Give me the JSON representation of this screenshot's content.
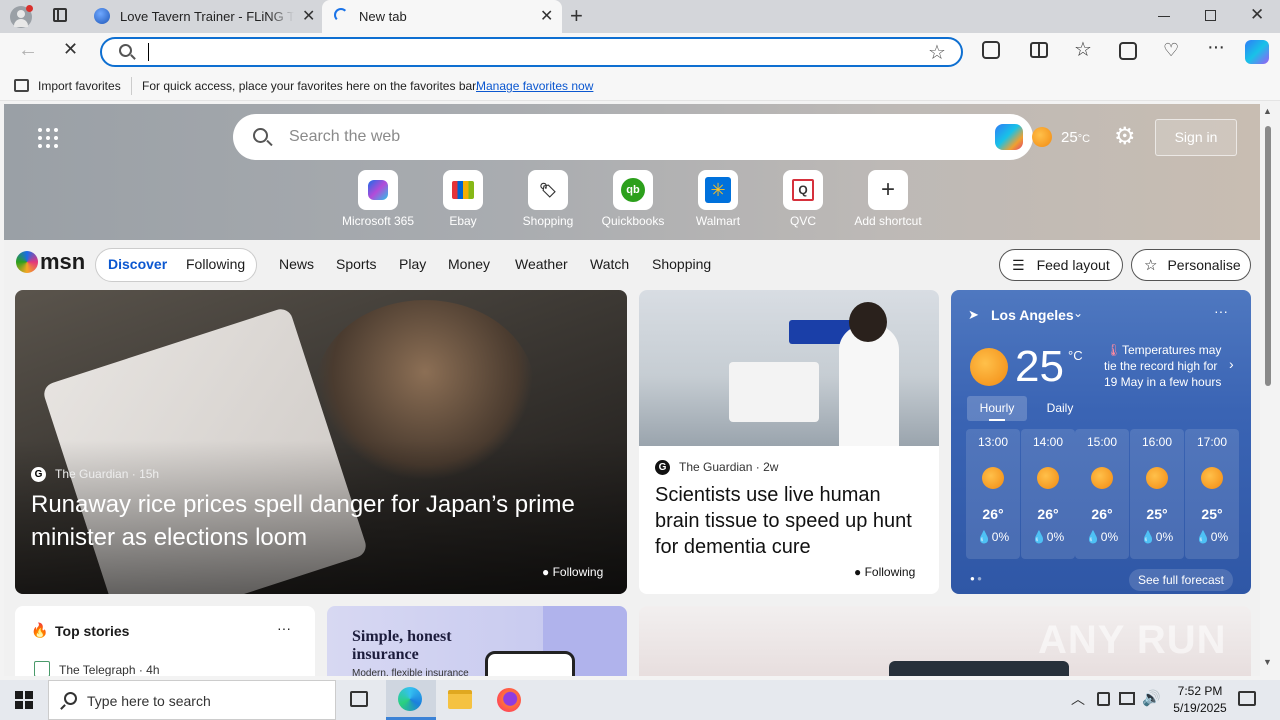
{
  "browser": {
    "tabs": [
      {
        "title": "Love Tavern Trainer - FLiNG Trainer"
      },
      {
        "title": "New tab"
      }
    ],
    "address_value": "",
    "favorites_bar": {
      "import_label": "Import favorites",
      "hint": "For quick access, place your favorites here on the favorites bar.",
      "manage_link": "Manage favorites now"
    }
  },
  "newtab": {
    "search_placeholder": "Search the web",
    "temperature": "25",
    "temp_unit": "°C",
    "sign_in": "Sign in",
    "shortcuts": [
      {
        "label": "Microsoft 365",
        "icon": "microsoft365-icon"
      },
      {
        "label": "Ebay",
        "icon": "ebay-icon"
      },
      {
        "label": "Shopping",
        "icon": "shopping-tag-icon"
      },
      {
        "label": "Quickbooks",
        "icon": "quickbooks-icon"
      },
      {
        "label": "Walmart",
        "icon": "walmart-icon"
      },
      {
        "label": "QVC",
        "icon": "qvc-icon"
      },
      {
        "label": "Add shortcut",
        "icon": "plus-icon"
      }
    ]
  },
  "msn": {
    "logo": "msn",
    "tabs": [
      "Discover",
      "Following"
    ],
    "nav": [
      "News",
      "Sports",
      "Play",
      "Money",
      "Weather",
      "Watch",
      "Shopping"
    ],
    "feed_layout": "Feed layout",
    "personalise": "Personalise",
    "hero_story": {
      "source": "The Guardian",
      "age": "15h",
      "title": "Runaway rice prices spell danger for Japan’s prime minister as elections loom",
      "following": "Following"
    },
    "second_story": {
      "source": "The Guardian",
      "age": "2w",
      "title": "Scientists use live human brain tissue to speed up hunt for dementia cure",
      "following": "Following"
    },
    "weather": {
      "location": "Los Angeles",
      "temp": "25",
      "unit": "°C",
      "alert": "Temperatures may tie the record high for 19 May in a few hours",
      "tabs": [
        "Hourly",
        "Daily"
      ],
      "hours": [
        {
          "time": "13:00",
          "temp": "26°",
          "precip": "0%"
        },
        {
          "time": "14:00",
          "temp": "26°",
          "precip": "0%"
        },
        {
          "time": "15:00",
          "temp": "26°",
          "precip": "0%"
        },
        {
          "time": "16:00",
          "temp": "25°",
          "precip": "0%"
        },
        {
          "time": "17:00",
          "temp": "25°",
          "precip": "0%"
        }
      ],
      "see_full": "See full forecast"
    },
    "top_stories": {
      "title": "Top stories",
      "first_source": "The Telegraph",
      "first_age": "4h"
    },
    "ad": {
      "headline": "Simple, honest insurance",
      "sub": "Modern, flexible insurance"
    }
  },
  "taskbar": {
    "search_placeholder": "Type here to search",
    "time": "7:52 PM",
    "date": "5/19/2025"
  },
  "watermark": "ANY RUN"
}
